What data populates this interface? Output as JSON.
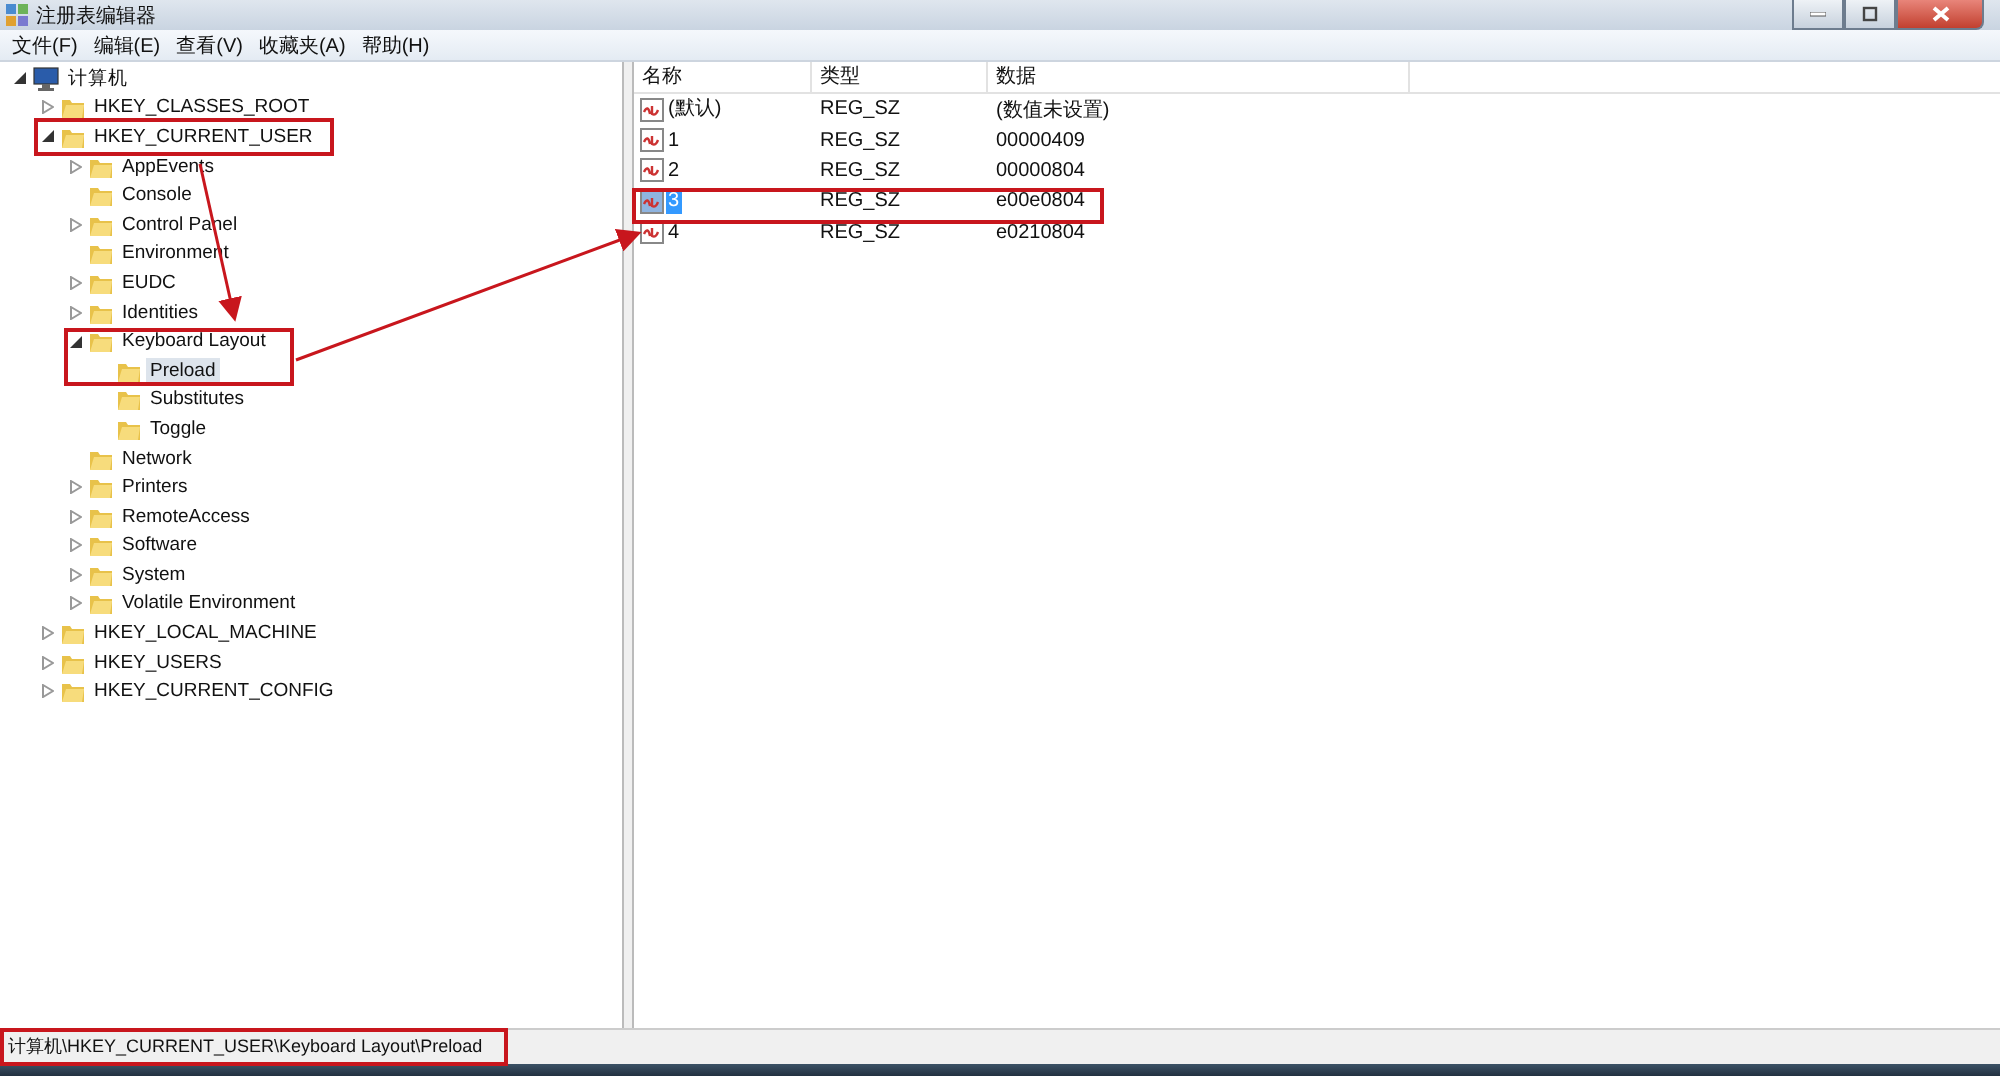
{
  "window": {
    "title": "注册表编辑器"
  },
  "menu": [
    "文件(F)",
    "编辑(E)",
    "查看(V)",
    "收藏夹(A)",
    "帮助(H)"
  ],
  "tree": {
    "label": "计算机",
    "kind": "computer",
    "expanded": true,
    "selected": false,
    "children": [
      {
        "label": "HKEY_CLASSES_ROOT",
        "expanded": false,
        "selected": false
      },
      {
        "label": "HKEY_CURRENT_USER",
        "expanded": true,
        "selected": false,
        "children": [
          {
            "label": "AppEvents",
            "expanded": false,
            "selected": false
          },
          {
            "label": "Console",
            "selected": false
          },
          {
            "label": "Control Panel",
            "expanded": false,
            "selected": false
          },
          {
            "label": "Environment",
            "selected": false
          },
          {
            "label": "EUDC",
            "expanded": false,
            "selected": false
          },
          {
            "label": "Identities",
            "expanded": false,
            "selected": false
          },
          {
            "label": "Keyboard Layout",
            "expanded": true,
            "selected": false,
            "children": [
              {
                "label": "Preload",
                "selected": true
              },
              {
                "label": "Substitutes",
                "selected": false
              },
              {
                "label": "Toggle",
                "selected": false
              }
            ]
          },
          {
            "label": "Network",
            "selected": false
          },
          {
            "label": "Printers",
            "expanded": false,
            "selected": false
          },
          {
            "label": "RemoteAccess",
            "expanded": false,
            "selected": false
          },
          {
            "label": "Software",
            "expanded": false,
            "selected": false
          },
          {
            "label": "System",
            "expanded": false,
            "selected": false
          },
          {
            "label": "Volatile Environment",
            "expanded": false,
            "selected": false
          }
        ]
      },
      {
        "label": "HKEY_LOCAL_MACHINE",
        "expanded": false,
        "selected": false
      },
      {
        "label": "HKEY_USERS",
        "expanded": false,
        "selected": false
      },
      {
        "label": "HKEY_CURRENT_CONFIG",
        "expanded": false,
        "selected": false
      }
    ]
  },
  "table": {
    "columns": [
      "名称",
      "类型",
      "数据"
    ],
    "rows": [
      {
        "name": "(默认)",
        "type": "REG_SZ",
        "data": "(数值未设置)",
        "selected": false
      },
      {
        "name": "1",
        "type": "REG_SZ",
        "data": "00000409",
        "selected": false
      },
      {
        "name": "2",
        "type": "REG_SZ",
        "data": "00000804",
        "selected": false
      },
      {
        "name": "3",
        "type": "REG_SZ",
        "data": "e00e0804",
        "selected": true
      },
      {
        "name": "4",
        "type": "REG_SZ",
        "data": "e0210804",
        "selected": false
      }
    ]
  },
  "status_bar": "计算机\\HKEY_CURRENT_USER\\Keyboard Layout\\Preload",
  "annotations": [
    {
      "kind": "box"
    },
    {
      "kind": "box"
    },
    {
      "kind": "box"
    },
    {
      "kind": "box"
    },
    {
      "kind": "arrow"
    },
    {
      "kind": "arrow"
    }
  ]
}
